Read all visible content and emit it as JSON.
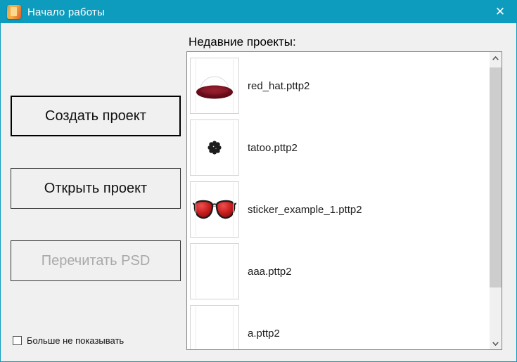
{
  "window": {
    "title": "Начало работы",
    "close_label": "✕"
  },
  "colors": {
    "titlebar": "#0d9cbe",
    "window_bg": "#f0f0f0",
    "list_border": "#828282",
    "scroll_thumb": "#cdcdcd",
    "disabled_text": "#a9a9a9",
    "hat_red": "#6d0e1c",
    "lens_red": "#c41a1a"
  },
  "buttons": {
    "create": "Создать проект",
    "open": "Открыть проект",
    "reread": "Перечитать PSD"
  },
  "checkbox": {
    "label": "Больше не показывать",
    "checked": false
  },
  "recent": {
    "header": "Недавние проекты:",
    "items": [
      {
        "label": "red_hat.pttp2",
        "thumbnail": "red-hat"
      },
      {
        "label": "tatoo.pttp2",
        "thumbnail": "tattoo-flower"
      },
      {
        "label": "sticker_example_1.pttp2",
        "thumbnail": "red-sunglasses"
      },
      {
        "label": "aaa.pttp2",
        "thumbnail": "empty"
      },
      {
        "label": "a.pttp2",
        "thumbnail": "empty"
      }
    ]
  }
}
